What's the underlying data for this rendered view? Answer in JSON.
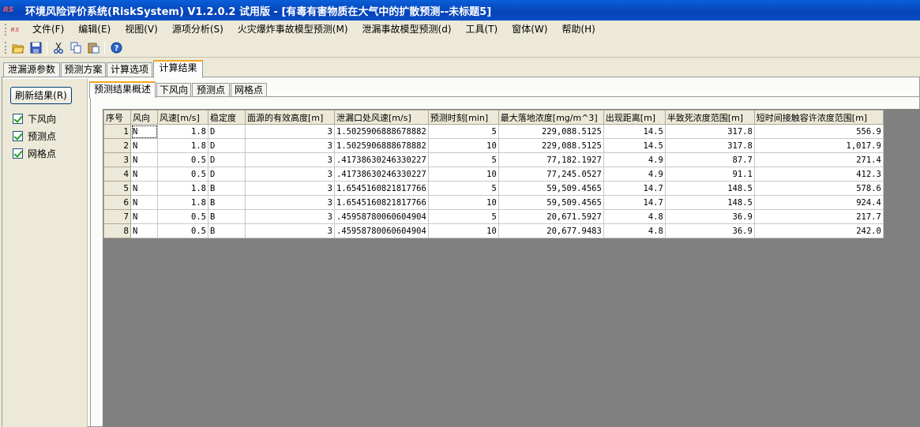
{
  "window": {
    "title": "环境风险评价系统(RiskSystem) V1.2.0.2 试用版 - [有毒有害物质在大气中的扩散预测--未标题5]",
    "logo": "RS"
  },
  "menu": [
    "文件(F)",
    "编辑(E)",
    "视图(V)",
    "源项分析(S)",
    "火灾爆炸事故模型预测(M)",
    "泄漏事故模型预测(d)",
    "工具(T)",
    "窗体(W)",
    "帮助(H)"
  ],
  "toolbar": {
    "icons": [
      "open-folder-icon",
      "save-icon",
      "cut-icon",
      "copy-icon",
      "paste-icon",
      "help-icon"
    ]
  },
  "outer_tabs": [
    "泄漏源参数",
    "预测方案",
    "计算选项",
    "计算结果"
  ],
  "outer_active": "计算结果",
  "inner_tabs": [
    "预测结果概述",
    "下风向",
    "预测点",
    "网格点"
  ],
  "inner_active": "预测结果概述",
  "left": {
    "refresh_label": "刷新结果(R)",
    "checkboxes": [
      {
        "label": "下风向",
        "checked": true
      },
      {
        "label": "预测点",
        "checked": true
      },
      {
        "label": "网格点",
        "checked": true
      }
    ]
  },
  "table": {
    "headers": [
      "序号",
      "风向",
      "风速[m/s]",
      "稳定度",
      "面源的有效高度[m]",
      "泄漏口处风速[m/s]",
      "预测时刻[min]",
      "最大落地浓度[mg/m^3]",
      "出现距离[m]",
      "半致死浓度范围[m]",
      "短时间接触容许浓度范围[m]"
    ],
    "rows": [
      [
        "1",
        "N",
        "1.8",
        "D",
        "3",
        "1.5025906888678882",
        "5",
        "229,088.5125",
        "14.5",
        "317.8",
        "556.9"
      ],
      [
        "2",
        "N",
        "1.8",
        "D",
        "3",
        "1.5025906888678882",
        "10",
        "229,088.5125",
        "14.5",
        "317.8",
        "1,017.9"
      ],
      [
        "3",
        "N",
        "0.5",
        "D",
        "3",
        ".4173863024633022​7",
        "5",
        "77,182.1927",
        "4.9",
        "87.7",
        "271.4"
      ],
      [
        "4",
        "N",
        "0.5",
        "D",
        "3",
        ".41738630246330227",
        "10",
        "77,245.0527",
        "4.9",
        "91.1",
        "412.3"
      ],
      [
        "5",
        "N",
        "1.8",
        "B",
        "3",
        "1.6545160821817766",
        "5",
        "59,509.4565",
        "14.7",
        "148.5",
        "578.6"
      ],
      [
        "6",
        "N",
        "1.8",
        "B",
        "3",
        "1.6545160821817766",
        "10",
        "59,509.4565",
        "14.7",
        "148.5",
        "924.4"
      ],
      [
        "7",
        "N",
        "0.5",
        "B",
        "3",
        ".45958780060604904",
        "5",
        "20,671.5927",
        "4.8",
        "36.9",
        "217.7"
      ],
      [
        "8",
        "N",
        "0.5",
        "B",
        "3",
        ".45958780060604904",
        "10",
        "20,677.9483",
        "4.8",
        "36.9",
        "242.0"
      ]
    ]
  }
}
